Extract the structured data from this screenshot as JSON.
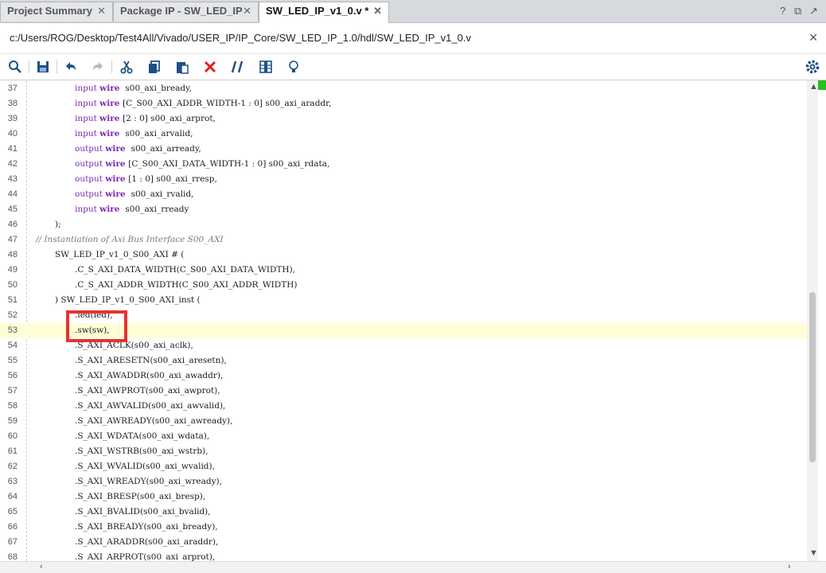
{
  "tabs": [
    {
      "label": "Project Summary",
      "active": false
    },
    {
      "label": "Package IP - SW_LED_IP",
      "active": false
    },
    {
      "label": "SW_LED_IP_v1_0.v *",
      "active": true
    }
  ],
  "tab_controls": {
    "help": "?",
    "restore": "⧉",
    "maximize": "↗"
  },
  "file_path": "c:/Users/ROG/Desktop/Test4All/Vivado/USER_IP/IP_Core/SW_LED_IP_1.0/hdl/SW_LED_IP_v1_0.v",
  "toolbar_icons": [
    "search-icon",
    "save-icon",
    "undo-icon",
    "redo-icon",
    "cut-icon",
    "copy-icon",
    "paste-icon",
    "delete-icon",
    "comment-icon",
    "column-select-icon",
    "lightbulb-icon",
    "settings-icon"
  ],
  "colors": {
    "keyword": "#7b2bb0",
    "comment": "#7a7a7a",
    "highlight_line": "#fffdd6",
    "callout": "#e8322e",
    "marker": "#22c022"
  },
  "code_lines": [
    {
      "n": "37",
      "indent": 94,
      "parts": [
        [
          "kw",
          "input "
        ],
        [
          "kw-b",
          "wire "
        ],
        [
          "",
          " s00_axi_bready,"
        ]
      ]
    },
    {
      "n": "38",
      "indent": 94,
      "parts": [
        [
          "kw",
          "input "
        ],
        [
          "kw-b",
          "wire "
        ],
        [
          "",
          "[C_S00_AXI_ADDR_WIDTH-1 : 0] s00_axi_araddr,"
        ]
      ]
    },
    {
      "n": "39",
      "indent": 94,
      "parts": [
        [
          "kw",
          "input "
        ],
        [
          "kw-b",
          "wire "
        ],
        [
          "",
          "[2 : 0] s00_axi_arprot,"
        ]
      ]
    },
    {
      "n": "40",
      "indent": 94,
      "parts": [
        [
          "kw",
          "input "
        ],
        [
          "kw-b",
          "wire "
        ],
        [
          "",
          " s00_axi_arvalid,"
        ]
      ]
    },
    {
      "n": "41",
      "indent": 94,
      "parts": [
        [
          "kw",
          "output "
        ],
        [
          "kw-b",
          "wire "
        ],
        [
          "",
          " s00_axi_arready,"
        ]
      ]
    },
    {
      "n": "42",
      "indent": 94,
      "parts": [
        [
          "kw",
          "output "
        ],
        [
          "kw-b",
          "wire "
        ],
        [
          "",
          "[C_S00_AXI_DATA_WIDTH-1 : 0] s00_axi_rdata,"
        ]
      ]
    },
    {
      "n": "43",
      "indent": 94,
      "parts": [
        [
          "kw",
          "output "
        ],
        [
          "kw-b",
          "wire "
        ],
        [
          "",
          "[1 : 0] s00_axi_rresp,"
        ]
      ]
    },
    {
      "n": "44",
      "indent": 94,
      "parts": [
        [
          "kw",
          "output "
        ],
        [
          "kw-b",
          "wire "
        ],
        [
          "",
          " s00_axi_rvalid,"
        ]
      ]
    },
    {
      "n": "45",
      "indent": 94,
      "parts": [
        [
          "kw",
          "input "
        ],
        [
          "kw-b",
          "wire "
        ],
        [
          "",
          " s00_axi_rready"
        ]
      ]
    },
    {
      "n": "46",
      "indent": 69,
      "parts": [
        [
          "",
          ");"
        ]
      ]
    },
    {
      "n": "47",
      "indent": 45,
      "parts": [
        [
          "cm",
          "// Instantiation of Axi Bus Interface S00_AXI"
        ]
      ]
    },
    {
      "n": "48",
      "indent": 69,
      "parts": [
        [
          "",
          "SW_LED_IP_v1_0_S00_AXI # ("
        ]
      ]
    },
    {
      "n": "49",
      "indent": 94,
      "parts": [
        [
          "",
          ".C_S_AXI_DATA_WIDTH(C_S00_AXI_DATA_WIDTH),"
        ]
      ]
    },
    {
      "n": "50",
      "indent": 94,
      "parts": [
        [
          "",
          ".C_S_AXI_ADDR_WIDTH(C_S00_AXI_ADDR_WIDTH)"
        ]
      ]
    },
    {
      "n": "51",
      "indent": 69,
      "parts": [
        [
          "",
          ") SW_LED_IP_v1_0_S00_AXI_inst ("
        ]
      ]
    },
    {
      "n": "52",
      "indent": 94,
      "parts": [
        [
          "",
          ".led(led),"
        ]
      ]
    },
    {
      "n": "53",
      "indent": 94,
      "parts": [
        [
          "",
          ".sw(sw),"
        ]
      ],
      "highlight": true
    },
    {
      "n": "54",
      "indent": 94,
      "parts": [
        [
          "",
          ".S_AXI_ACLK(s00_axi_aclk),"
        ]
      ]
    },
    {
      "n": "55",
      "indent": 94,
      "parts": [
        [
          "",
          ".S_AXI_ARESETN(s00_axi_aresetn),"
        ]
      ]
    },
    {
      "n": "56",
      "indent": 94,
      "parts": [
        [
          "",
          ".S_AXI_AWADDR(s00_axi_awaddr),"
        ]
      ]
    },
    {
      "n": "57",
      "indent": 94,
      "parts": [
        [
          "",
          ".S_AXI_AWPROT(s00_axi_awprot),"
        ]
      ]
    },
    {
      "n": "58",
      "indent": 94,
      "parts": [
        [
          "",
          ".S_AXI_AWVALID(s00_axi_awvalid),"
        ]
      ]
    },
    {
      "n": "59",
      "indent": 94,
      "parts": [
        [
          "",
          ".S_AXI_AWREADY(s00_axi_awready),"
        ]
      ]
    },
    {
      "n": "60",
      "indent": 94,
      "parts": [
        [
          "",
          ".S_AXI_WDATA(s00_axi_wdata),"
        ]
      ]
    },
    {
      "n": "61",
      "indent": 94,
      "parts": [
        [
          "",
          ".S_AXI_WSTRB(s00_axi_wstrb),"
        ]
      ]
    },
    {
      "n": "62",
      "indent": 94,
      "parts": [
        [
          "",
          ".S_AXI_WVALID(s00_axi_wvalid),"
        ]
      ]
    },
    {
      "n": "63",
      "indent": 94,
      "parts": [
        [
          "",
          ".S_AXI_WREADY(s00_axi_wready),"
        ]
      ]
    },
    {
      "n": "64",
      "indent": 94,
      "parts": [
        [
          "",
          ".S_AXI_BRESP(s00_axi_bresp),"
        ]
      ]
    },
    {
      "n": "65",
      "indent": 94,
      "parts": [
        [
          "",
          ".S_AXI_BVALID(s00_axi_bvalid),"
        ]
      ]
    },
    {
      "n": "66",
      "indent": 94,
      "parts": [
        [
          "",
          ".S_AXI_BREADY(s00_axi_bready),"
        ]
      ]
    },
    {
      "n": "67",
      "indent": 94,
      "parts": [
        [
          "",
          ".S_AXI_ARADDR(s00_axi_araddr),"
        ]
      ]
    },
    {
      "n": "68",
      "indent": 94,
      "parts": [
        [
          "",
          ".S_AXI_ARPROT(s00_axi_arprot),"
        ]
      ]
    }
  ]
}
